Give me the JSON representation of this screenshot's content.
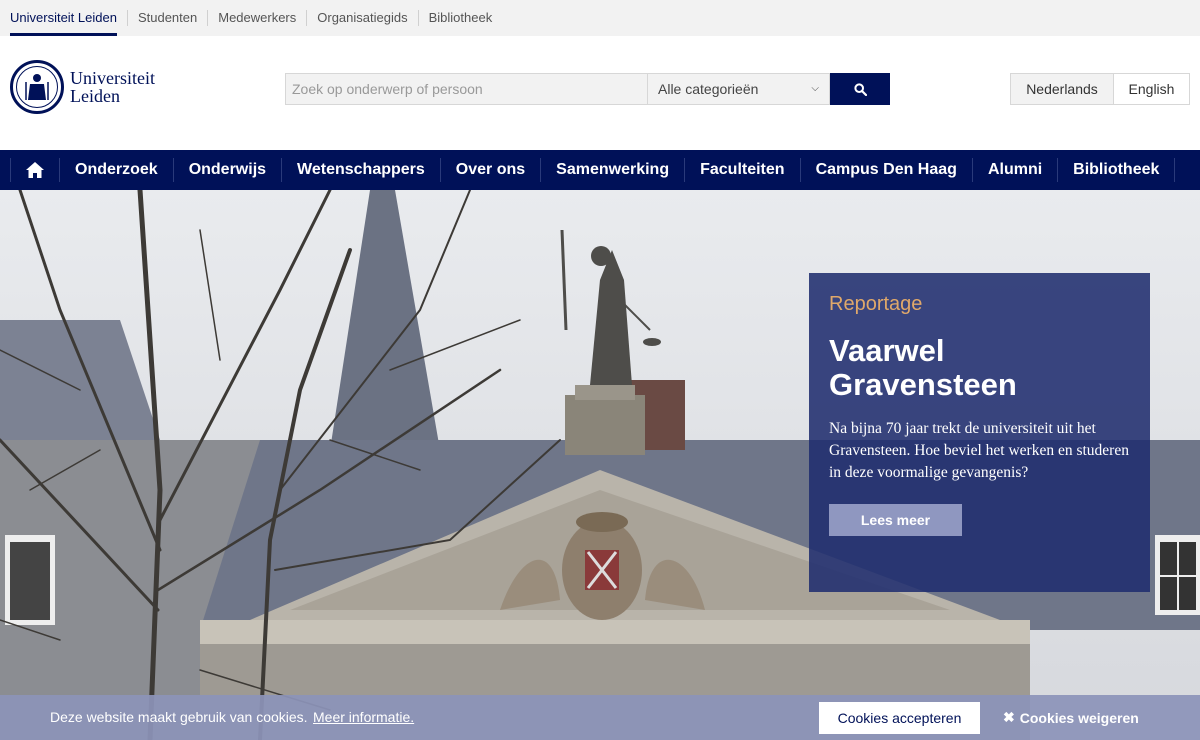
{
  "topbar": {
    "items": [
      {
        "label": "Universiteit Leiden"
      },
      {
        "label": "Studenten"
      },
      {
        "label": "Medewerkers"
      },
      {
        "label": "Organisatiegids"
      },
      {
        "label": "Bibliotheek"
      }
    ]
  },
  "header": {
    "logo_line1": "Universiteit",
    "logo_line2": "Leiden",
    "search_placeholder": "Zoek op onderwerp of persoon",
    "category_selected": "Alle categorieën",
    "lang_nl": "Nederlands",
    "lang_en": "English"
  },
  "nav": {
    "items": [
      {
        "label": "Onderzoek"
      },
      {
        "label": "Onderwijs"
      },
      {
        "label": "Wetenschappers"
      },
      {
        "label": "Over ons"
      },
      {
        "label": "Samenwerking"
      },
      {
        "label": "Faculteiten"
      },
      {
        "label": "Campus Den Haag"
      },
      {
        "label": "Alumni"
      },
      {
        "label": "Bibliotheek"
      }
    ]
  },
  "hero": {
    "kicker": "Reportage",
    "title_line1": "Vaarwel",
    "title_line2": "Gravensteen",
    "description": "Na bijna 70 jaar trekt de universiteit uit het Gravensteen. Hoe beviel het werken en studeren in deze voormalige gevangenis?",
    "button_label": "Lees meer"
  },
  "cookie": {
    "message": "Deze website maakt gebruik van cookies.",
    "more_info": "Meer informatie.",
    "accept": "Cookies accepteren",
    "reject": "Cookies weigeren"
  },
  "colors": {
    "brand": "#001158",
    "card": "#202d6e",
    "kicker": "#e0a86a"
  }
}
